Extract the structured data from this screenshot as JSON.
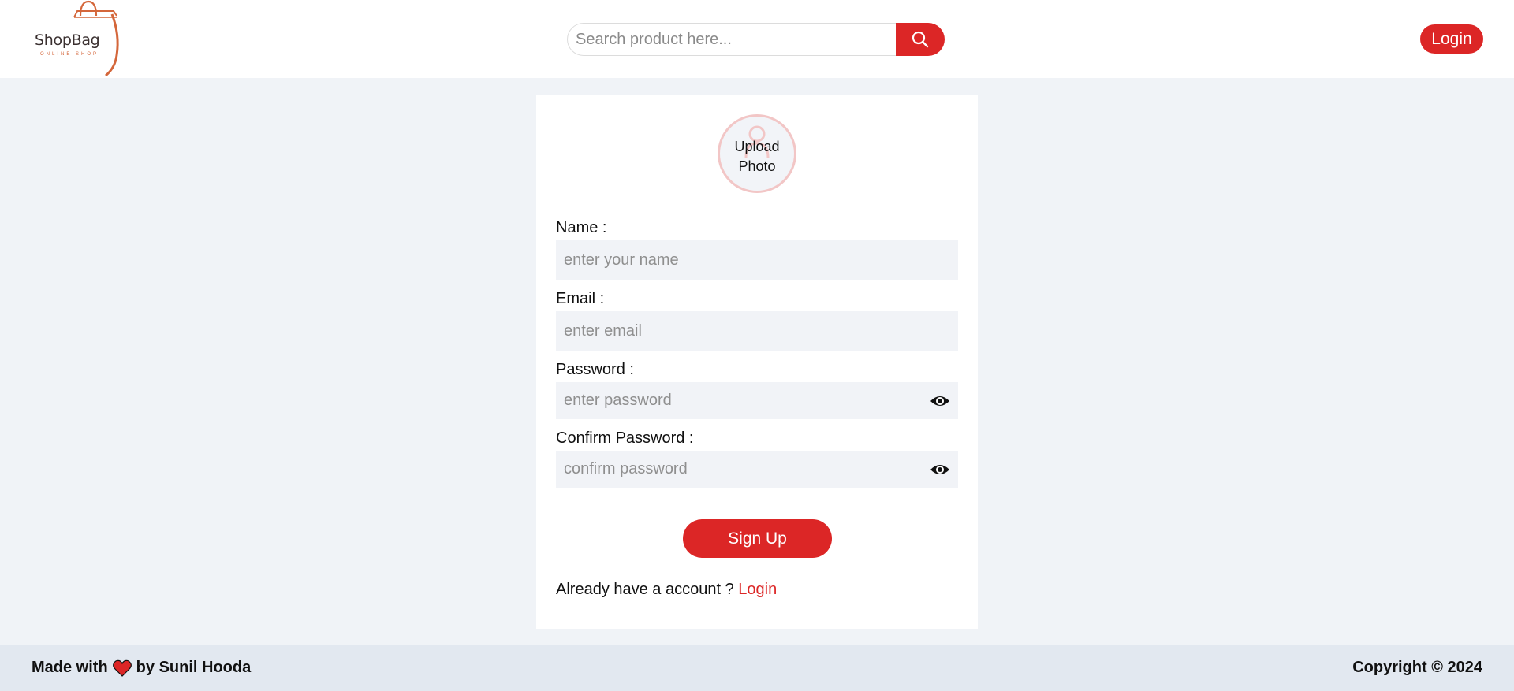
{
  "header": {
    "logo": {
      "name": "ShopBag",
      "tagline": "ONLINE SHOP"
    },
    "search": {
      "placeholder": "Search product here...",
      "icon": "search-icon"
    },
    "login_label": "Login"
  },
  "signup_form": {
    "upload_photo_label": "Upload Photo",
    "fields": [
      {
        "label": "Name :",
        "placeholder": "enter your name",
        "value": ""
      },
      {
        "label": "Email :",
        "placeholder": "enter email",
        "value": ""
      },
      {
        "label": "Password :",
        "placeholder": "enter password",
        "value": "",
        "icon": "eye-icon"
      },
      {
        "label": "Confirm Password :",
        "placeholder": "confirm password",
        "value": "",
        "icon": "eye-icon"
      }
    ],
    "submit_label": "Sign Up",
    "account_prompt": "Already have a account ?",
    "login_link": "Login"
  },
  "footer": {
    "made_with": "Made with",
    "by": "by Sunil Hooda",
    "copyright": "Copyright © 2024"
  },
  "colors": {
    "accent": "#dc2626",
    "page_background": "#f0f3f7",
    "footer_background": "#e2e8f0",
    "input_background": "#f1f3f7"
  }
}
